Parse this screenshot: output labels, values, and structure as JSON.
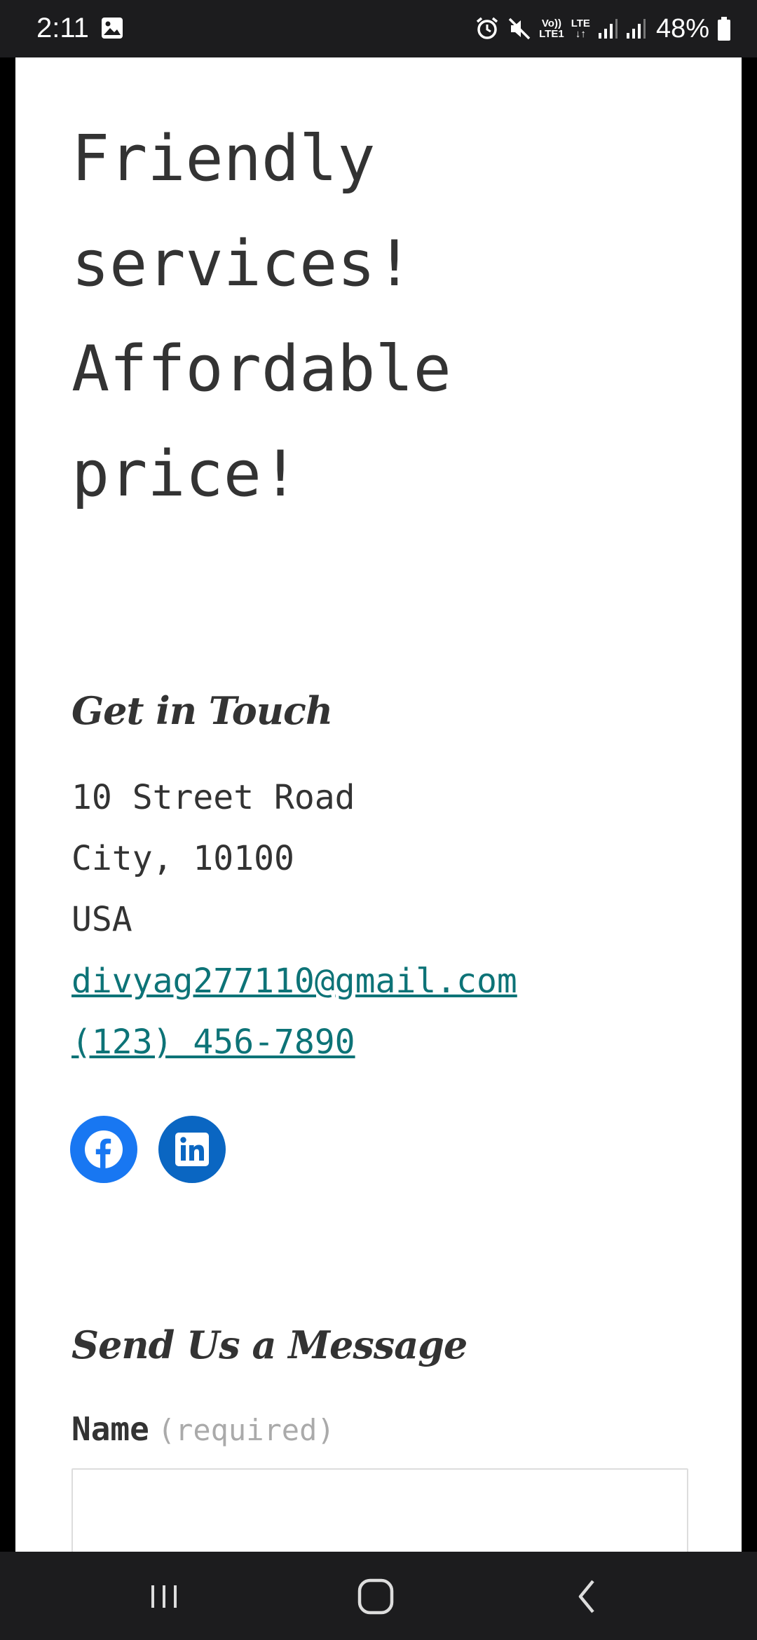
{
  "status_bar": {
    "time": "2:11",
    "volte_label": "Vo))",
    "lte1_label": "LTE1",
    "lte_label": "LTE",
    "battery": "48%",
    "icons": [
      "gallery-icon",
      "alarm-icon",
      "mute-icon",
      "signal-icon",
      "battery-icon"
    ]
  },
  "hero": {
    "text": "Friendly\nservices!\nAffordable\nprice!"
  },
  "contact": {
    "title": "Get in Touch",
    "address_line1": "10 Street Road",
    "address_line2": "City, 10100",
    "address_line3": "USA",
    "email": "divyag277110@gmail.com",
    "phone": "(123) 456-7890"
  },
  "social": {
    "facebook_color": "#1877f2",
    "linkedin_color": "#0a66c2",
    "icons": [
      "facebook-icon",
      "linkedin-icon"
    ]
  },
  "message_form": {
    "title": "Send Us a Message",
    "name_label": "Name",
    "name_required": "(required)",
    "name_value": ""
  },
  "colors": {
    "link": "#0d7377",
    "text": "#333333",
    "muted": "#aaaaaa"
  },
  "nav_bar": {
    "icons": [
      "recents-icon",
      "home-icon",
      "back-icon"
    ]
  }
}
